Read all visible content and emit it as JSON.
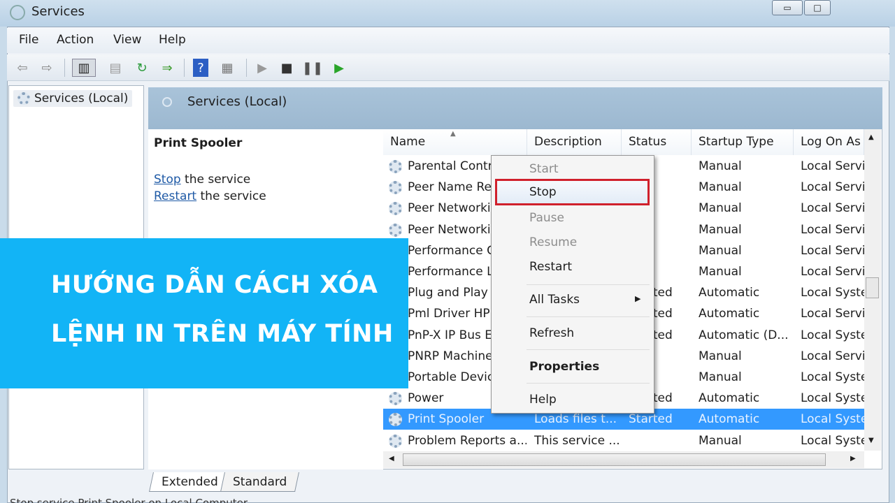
{
  "window": {
    "title": "Services",
    "minimize": "▭",
    "maximize": "□"
  },
  "menu": [
    "File",
    "Action",
    "View",
    "Help"
  ],
  "toolbar": [
    "back-icon",
    "forward-icon",
    "console-tree-icon",
    "properties-icon",
    "refresh-icon",
    "export-icon",
    "help-icon",
    "show-hide-icon",
    "start-icon",
    "stop-icon",
    "pause-icon",
    "resume-icon"
  ],
  "tree": {
    "item": "Services (Local)"
  },
  "band": {
    "title": "Services (Local)"
  },
  "detail": {
    "title": "Print Spooler",
    "stop_link": "Stop",
    "stop_rest": " the service",
    "restart_link": "Restart",
    "restart_rest": " the service"
  },
  "columns": [
    "Name",
    "Description",
    "Status",
    "Startup Type",
    "Log On As"
  ],
  "rows": [
    {
      "name": "Parental Controls",
      "desc": "",
      "status": "",
      "startup": "Manual",
      "logon": "Local Service"
    },
    {
      "name": "Peer Name Resolution",
      "desc": "",
      "status": "",
      "startup": "Manual",
      "logon": "Local Service"
    },
    {
      "name": "Peer Networking",
      "desc": "",
      "status": "",
      "startup": "Manual",
      "logon": "Local Service"
    },
    {
      "name": "Peer Networking",
      "desc": "",
      "status": "",
      "startup": "Manual",
      "logon": "Local Service"
    },
    {
      "name": "Performance C",
      "desc": "",
      "status": "",
      "startup": "Manual",
      "logon": "Local Service"
    },
    {
      "name": "Performance L",
      "desc": "",
      "status": "",
      "startup": "Manual",
      "logon": "Local Service"
    },
    {
      "name": "Plug and Play",
      "desc": "",
      "status": "Started",
      "startup": "Automatic",
      "logon": "Local System"
    },
    {
      "name": "Pml Driver HP",
      "desc": "",
      "status": "Started",
      "startup": "Automatic",
      "logon": "Local Service"
    },
    {
      "name": "PnP-X IP Bus E",
      "desc": "",
      "status": "Started",
      "startup": "Automatic (D...",
      "logon": "Local System"
    },
    {
      "name": "PNRP Machine",
      "desc": "",
      "status": "",
      "startup": "Manual",
      "logon": "Local Service"
    },
    {
      "name": "Portable Device",
      "desc": "",
      "status": "",
      "startup": "Manual",
      "logon": "Local System"
    },
    {
      "name": "Power",
      "desc": "",
      "status": "Started",
      "startup": "Automatic",
      "logon": "Local System"
    },
    {
      "name": "Print Spooler",
      "desc": "Loads files t...",
      "status": "Started",
      "startup": "Automatic",
      "logon": "Local System",
      "selected": true
    },
    {
      "name": "Problem Reports a...",
      "desc": "This service ...",
      "status": "",
      "startup": "Manual",
      "logon": "Local System"
    }
  ],
  "context_menu": {
    "start": "Start",
    "stop": "Stop",
    "pause": "Pause",
    "resume": "Resume",
    "restart": "Restart",
    "all_tasks": "All Tasks",
    "refresh": "Refresh",
    "properties": "Properties",
    "help": "Help"
  },
  "tabs": {
    "extended": "Extended",
    "standard": "Standard"
  },
  "status_bar": "Stop service Print Spooler on Local Computer",
  "banner": {
    "line1": "HƯỚNG DẪN CÁCH XÓA",
    "line2": "LỆNH IN TRÊN MÁY TÍNH",
    "color": "#12b4f6"
  },
  "colors": {
    "highlight": "#3399ff",
    "stop_outline": "#d0202c"
  }
}
